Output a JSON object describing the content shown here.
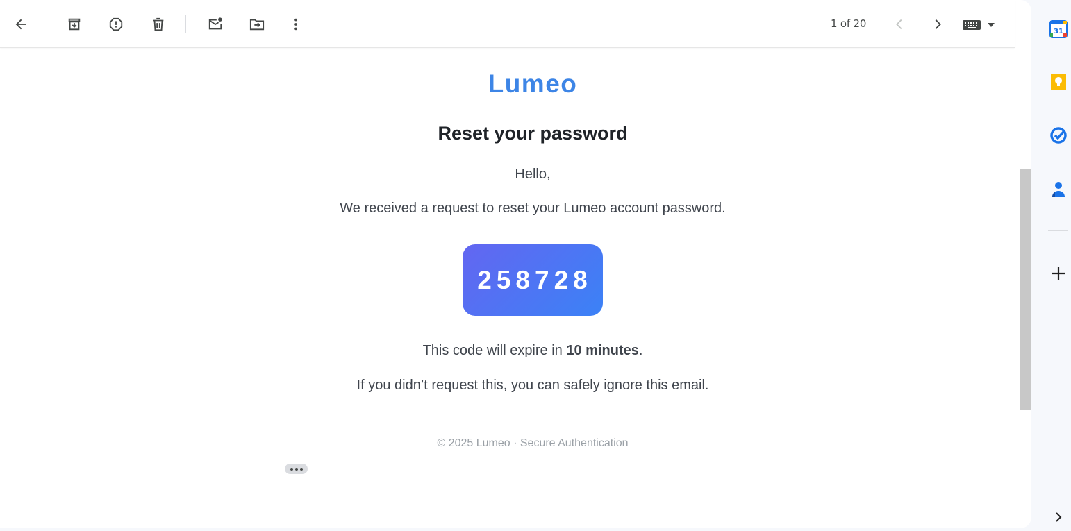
{
  "toolbar": {
    "back_label": "Back",
    "archive_label": "Archive",
    "spam_label": "Report spam",
    "delete_label": "Delete",
    "unread_label": "Mark as unread",
    "move_label": "Move to",
    "more_label": "More",
    "count": "1 of 20",
    "prev_label": "Newer",
    "next_label": "Older",
    "input_tools_label": "Input tools"
  },
  "email": {
    "brand": "Lumeo",
    "heading": "Reset your password",
    "greeting": "Hello,",
    "body": "We received a request to reset your Lumeo account password.",
    "code": "258728",
    "expire_prefix": "This code will expire in ",
    "expire_bold": "10 minutes",
    "expire_suffix": ".",
    "ignore": "If you didn’t request this, you can safely ignore this email.",
    "footer": "© 2025 Lumeo · Secure Authentication"
  },
  "side_panel": {
    "calendar_date": "31",
    "apps": [
      "calendar-icon",
      "keep-icon",
      "tasks-icon",
      "contacts-icon",
      "add-icon",
      "expand-icon"
    ]
  },
  "colors": {
    "brand": "#3d85e6",
    "code_gradient_start": "#6366f1",
    "code_gradient_end": "#3b82f6",
    "keep": "#fbbc04",
    "tasks": "#1a73e8",
    "contacts": "#1a73e8"
  }
}
